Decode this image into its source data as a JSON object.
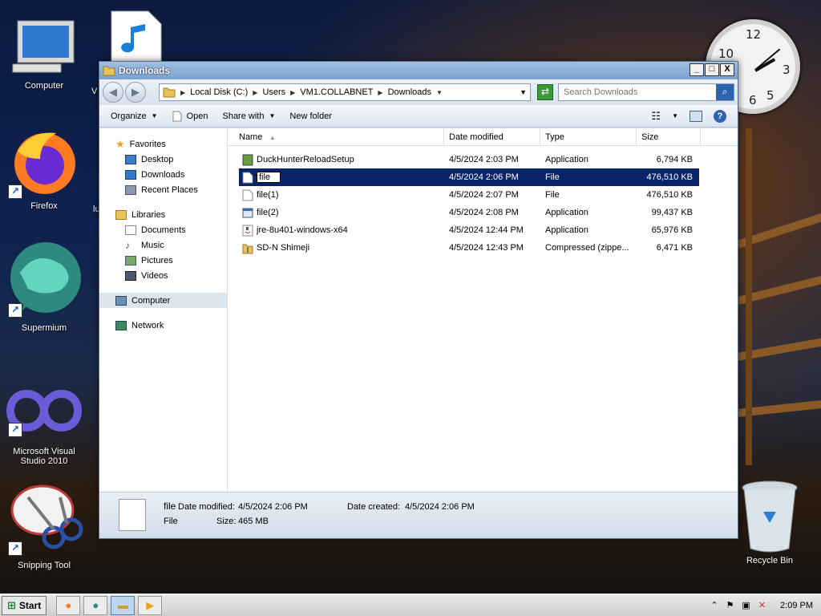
{
  "desktop": {
    "icons": [
      {
        "label": "Computer"
      },
      {
        "label": "V"
      },
      {
        "label": "Firefox"
      },
      {
        "label": "lu"
      },
      {
        "label": "Supermium"
      },
      {
        "label": "Microsoft Visual Studio 2010"
      },
      {
        "label": "Snipping Tool"
      }
    ],
    "recycle_bin": "Recycle Bin",
    "clock": {
      "n12": "12",
      "n10": "10",
      "n3": "3",
      "n6": "6",
      "n5": "5"
    }
  },
  "window": {
    "title": "Downloads",
    "buttons": {
      "minimize": "_",
      "maximize": "□",
      "close": "X"
    },
    "address": {
      "crumbs": [
        "Local Disk (C:)",
        "Users",
        "VM1.COLLABNET",
        "Downloads"
      ]
    },
    "search": {
      "placeholder": "Search Downloads"
    },
    "toolbar": {
      "organize": "Organize",
      "open": "Open",
      "share_with": "Share with",
      "new_folder": "New folder"
    },
    "nav": {
      "favorites": "Favorites",
      "desktop": "Desktop",
      "downloads": "Downloads",
      "recent_places": "Recent Places",
      "libraries": "Libraries",
      "documents": "Documents",
      "music": "Music",
      "pictures": "Pictures",
      "videos": "Videos",
      "computer": "Computer",
      "network": "Network"
    },
    "columns": {
      "name": "Name",
      "date": "Date modified",
      "type": "Type",
      "size": "Size"
    },
    "files": [
      {
        "name": "DuckHunterReloadSetup",
        "date": "4/5/2024 2:03 PM",
        "type": "Application",
        "size": "6,794 KB"
      },
      {
        "name": "file",
        "date": "4/5/2024 2:06 PM",
        "type": "File",
        "size": "476,510 KB"
      },
      {
        "name": "file(1)",
        "date": "4/5/2024 2:07 PM",
        "type": "File",
        "size": "476,510 KB"
      },
      {
        "name": "file(2)",
        "date": "4/5/2024 2:08 PM",
        "type": "Application",
        "size": "99,437 KB"
      },
      {
        "name": "jre-8u401-windows-x64",
        "date": "4/5/2024 12:44 PM",
        "type": "Application",
        "size": "65,976 KB"
      },
      {
        "name": "SD-N Shimeji",
        "date": "4/5/2024 12:43 PM",
        "type": "Compressed (zippe...",
        "size": "6,471 KB"
      }
    ],
    "details": {
      "name": "file",
      "type": "File",
      "date_modified_label": "Date modified:",
      "date_modified": "4/5/2024 2:06 PM",
      "date_created_label": "Date created:",
      "date_created": "4/5/2024 2:06 PM",
      "size_label": "Size:",
      "size": "465 MB"
    }
  },
  "taskbar": {
    "start": "Start",
    "time": "2:09 PM"
  }
}
